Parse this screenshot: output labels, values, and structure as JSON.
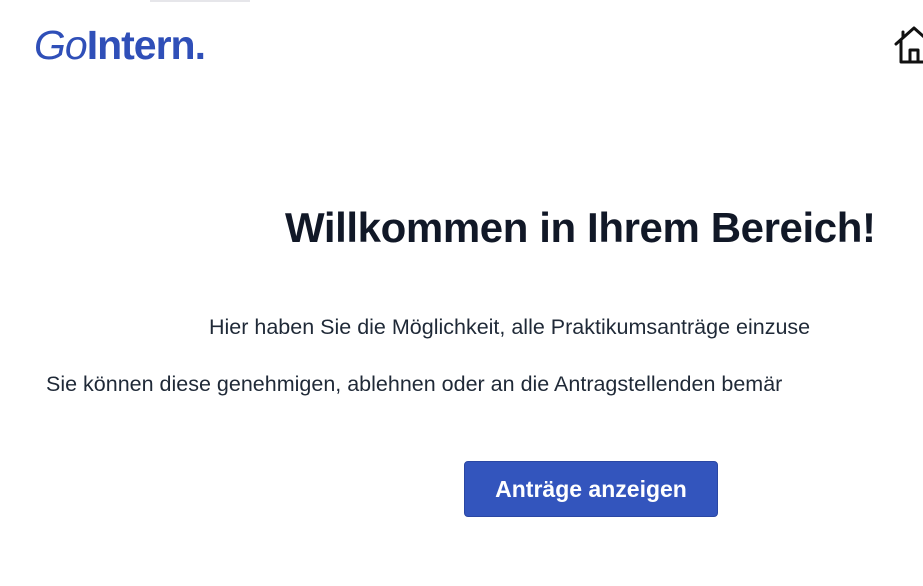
{
  "header": {
    "logo_part_1": "Go",
    "logo_part_2": "Intern.",
    "home_icon": "home-icon"
  },
  "main": {
    "title": "Willkommen in Ihrem Bereich!",
    "description_line_1": "Hier haben Sie die Möglichkeit, alle Praktikumsanträge einzuse",
    "description_line_2": "Sie können diese genehmigen, ablehnen oder an die Antragstellenden bemär",
    "cta_label": "Anträge anzeigen"
  },
  "colors": {
    "brand": "#2f4fb8",
    "button_bg": "#3355bd",
    "button_text": "#ffffff",
    "title_text": "#111827",
    "body_text": "#1f2937",
    "background": "#ffffff"
  }
}
